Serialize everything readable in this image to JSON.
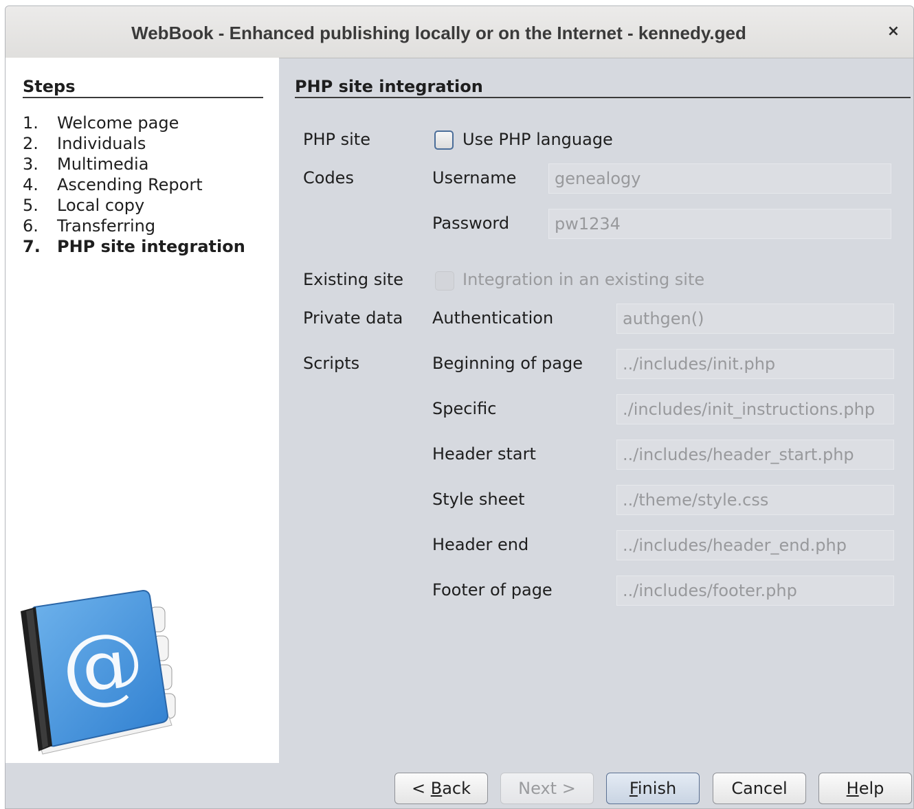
{
  "window": {
    "title": "WebBook - Enhanced publishing locally or on the Internet - kennedy.ged",
    "close_label": "×"
  },
  "steps": {
    "heading": "Steps",
    "items": [
      {
        "num": "1.",
        "label": "Welcome page"
      },
      {
        "num": "2.",
        "label": "Individuals"
      },
      {
        "num": "3.",
        "label": "Multimedia"
      },
      {
        "num": "4.",
        "label": "Ascending Report"
      },
      {
        "num": "5.",
        "label": "Local copy"
      },
      {
        "num": "6.",
        "label": "Transferring"
      },
      {
        "num": "7.",
        "label": "PHP site integration",
        "current": true
      }
    ]
  },
  "page": {
    "heading": "PHP site integration",
    "php_site": {
      "label": "PHP site",
      "checkbox_label": "Use PHP language",
      "checked": false
    },
    "codes": {
      "label": "Codes",
      "username_label": "Username",
      "username_value": "genealogy",
      "password_label": "Password",
      "password_value": "pw1234"
    },
    "existing_site": {
      "label": "Existing site",
      "checkbox_label": "Integration in an existing site",
      "checked": false,
      "enabled": false
    },
    "private_data": {
      "label": "Private data",
      "auth_label": "Authentication",
      "auth_value": "authgen()"
    },
    "scripts": {
      "label": "Scripts",
      "beginning_label": "Beginning of page",
      "beginning_value": "../includes/init.php",
      "specific_label": "Specific",
      "specific_value": "./includes/init_instructions.php",
      "header_start_label": "Header start",
      "header_start_value": "../includes/header_start.php",
      "style_sheet_label": "Style sheet",
      "style_sheet_value": "../theme/style.css",
      "header_end_label": "Header end",
      "header_end_value": "../includes/header_end.php",
      "footer_label": "Footer of page",
      "footer_value": "../includes/footer.php"
    }
  },
  "buttons": {
    "back": {
      "prefix": "< ",
      "mnemonic": "B",
      "rest": "ack"
    },
    "next": "Next >",
    "finish": {
      "mnemonic": "F",
      "rest": "inish"
    },
    "cancel": "Cancel",
    "help": {
      "mnemonic": "H",
      "rest": "elp"
    }
  },
  "colors": {
    "window_bg": "#d6d9df",
    "field_bg": "#dcdee3",
    "disabled_text": "#98999c",
    "checkbox_border": "#4a6d99"
  }
}
